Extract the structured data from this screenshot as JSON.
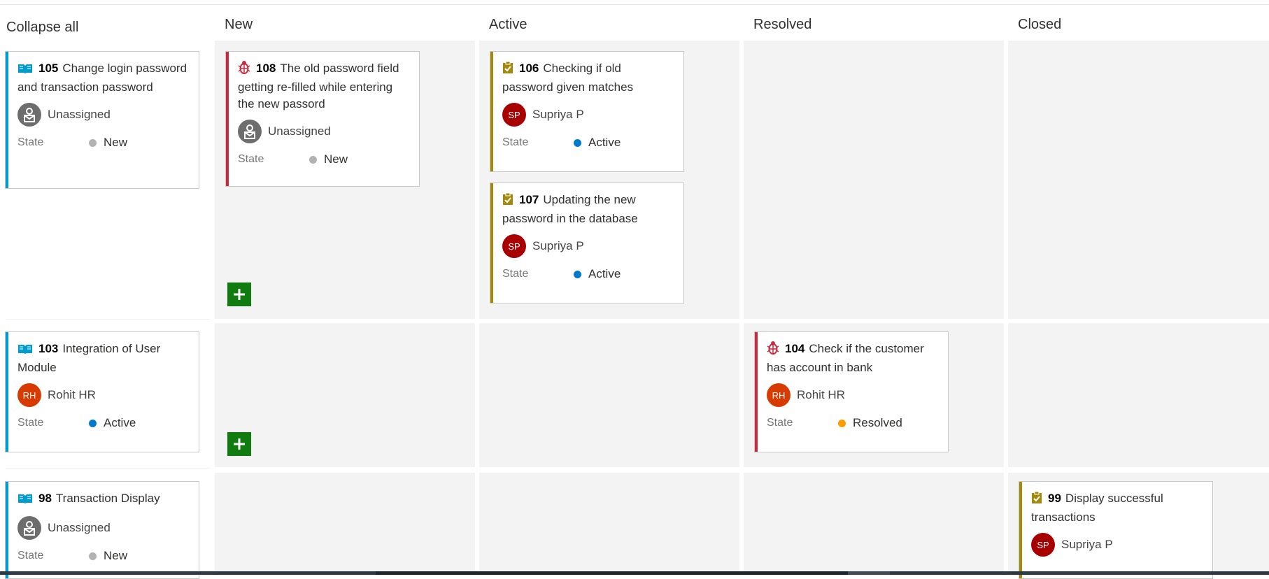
{
  "board": {
    "collapse_label": "Collapse all",
    "columns": [
      "New",
      "Active",
      "Resolved",
      "Closed"
    ]
  },
  "cards": {
    "c105": {
      "type": "user-story",
      "id": "105",
      "title": "Change login password and transaction password",
      "assignee": "Unassigned",
      "state_label": "State",
      "state": "New"
    },
    "c108": {
      "type": "bug",
      "id": "108",
      "title": "The old password field getting re-filled while entering the new passord",
      "assignee": "Unassigned",
      "state_label": "State",
      "state": "New"
    },
    "c106": {
      "type": "task",
      "id": "106",
      "title": "Checking if old password given matches",
      "assignee": "Supriya P",
      "initials": "SP",
      "state_label": "State",
      "state": "Active"
    },
    "c107": {
      "type": "task",
      "id": "107",
      "title": "Updating the new password in the database",
      "assignee": "Supriya P",
      "initials": "SP",
      "state_label": "State",
      "state": "Active"
    },
    "c103": {
      "type": "user-story",
      "id": "103",
      "title": "Integration of User Module",
      "assignee": "Rohit HR",
      "initials": "RH",
      "state_label": "State",
      "state": "Active"
    },
    "c104": {
      "type": "bug",
      "id": "104",
      "title": "Check if the customer has account in bank",
      "assignee": "Rohit HR",
      "initials": "RH",
      "state_label": "State",
      "state": "Resolved"
    },
    "c98": {
      "type": "user-story",
      "id": "98",
      "title": "Transaction Display",
      "assignee": "Unassigned",
      "state_label": "State",
      "state": "New"
    },
    "c99": {
      "type": "task",
      "id": "99",
      "title": "Display successful transactions",
      "assignee": "Supriya P",
      "initials": "SP"
    }
  },
  "colors": {
    "user_story": "#009ccc",
    "bug": "#cc293d",
    "task": "#a4880a",
    "state_new": "#b2b2b2",
    "state_active": "#007acc",
    "state_resolved": "#ff9d00",
    "avatar_sp": "#a80000",
    "avatar_rh": "#d83b01",
    "add_button": "#107c10"
  },
  "icons": {
    "user_story": "book-icon",
    "bug": "bug-icon",
    "task": "clipboard-check-icon",
    "add": "plus-icon"
  }
}
